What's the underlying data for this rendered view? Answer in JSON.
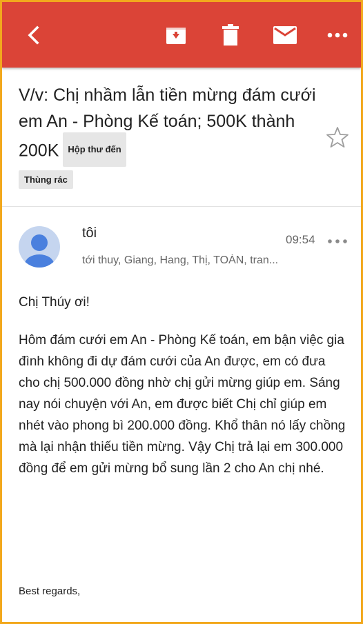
{
  "toolbar": {
    "back_icon": "arrow-left-icon",
    "archive_icon": "archive-icon",
    "delete_icon": "trash-icon",
    "mark_icon": "mail-icon",
    "more_icon": "more-horizontal-icon",
    "bg_color": "#db4437"
  },
  "email": {
    "subject": "V/v: Chị nhầm lẫn tiền mừng đám cưới em An - Phòng Kế toán; 500K thành 200K",
    "label_inbox": "Hộp thư đến",
    "label_trash": "Thùng rác",
    "sender": "tôi",
    "recipients": "tới thuy, Giang, Hang, Thị, TOÀN, tran...",
    "time": "09:54",
    "greeting": "Chị Thúy ơi!",
    "body": "Hôm đám cưới em An - Phòng Kế toán, em bận việc gia đình không đi dự đám cưới của An được, em có đưa cho chị 500.000 đồng nhờ chị gửi mừng giúp em. Sáng nay nói chuyện với An, em được biết Chị chỉ giúp em nhét vào phong bì 200.000 đồng. Khổ thân nó lấy chồng mà lại nhận thiếu tiền mừng. Vậy Chị trả lại em 300.000 đồng để em gửi mừng bổ sung lần 2 cho An chị nhé.",
    "signoff": "Best regards,"
  }
}
